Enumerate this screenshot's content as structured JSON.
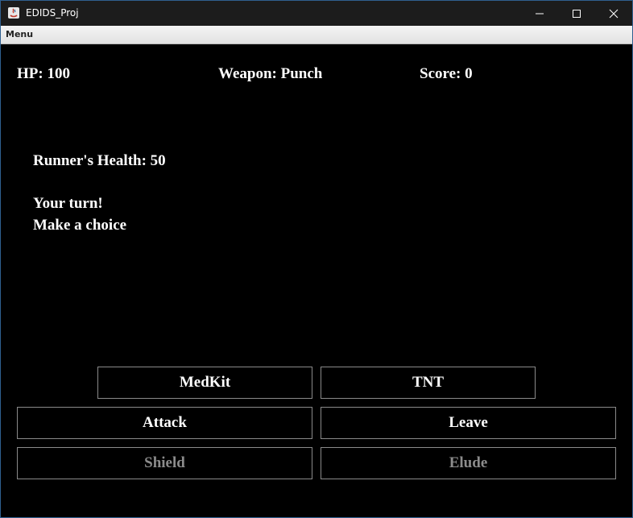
{
  "window": {
    "title": "EDIDS_Proj",
    "icon": "java-app-icon",
    "controls": [
      "minimize-icon",
      "maximize-icon",
      "close-icon"
    ]
  },
  "menubar": {
    "items": [
      {
        "label": "Menu"
      }
    ]
  },
  "status": {
    "hp": "HP: 100",
    "weapon": "Weapon: Punch",
    "score": "Score: 0"
  },
  "messages": {
    "enemy_health": "Runner's Health: 50",
    "turn": "Your turn!",
    "prompt": "Make a choice"
  },
  "actions": {
    "medkit": {
      "label": "MedKit",
      "enabled": true
    },
    "tnt": {
      "label": "TNT",
      "enabled": true
    },
    "attack": {
      "label": "Attack",
      "enabled": true
    },
    "leave": {
      "label": "Leave",
      "enabled": true
    },
    "shield": {
      "label": "Shield",
      "enabled": false
    },
    "elude": {
      "label": "Elude",
      "enabled": false
    }
  },
  "colors": {
    "background": "#000000",
    "text": "#ffffff",
    "disabled_text": "#8c8c8c",
    "button_border": "#8a8a8a",
    "titlebar": "#1c1c1c"
  }
}
